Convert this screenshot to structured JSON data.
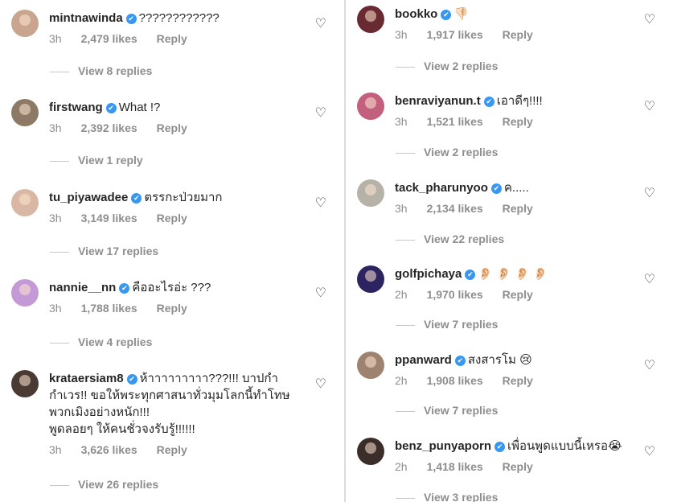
{
  "left": [
    {
      "username": "mintnawinda",
      "text": "????????????",
      "extra": [],
      "time": "3h",
      "likes": "2,479 likes",
      "reply": "Reply",
      "view": "View 8 replies",
      "avatar": "#c9a48f"
    },
    {
      "username": "firstwang",
      "text": "What !?",
      "extra": [],
      "time": "3h",
      "likes": "2,392 likes",
      "reply": "Reply",
      "view": "View 1 reply",
      "avatar": "#8c7a66"
    },
    {
      "username": "tu_piyawadee",
      "text": "ตรรกะป่วยมาก",
      "extra": [],
      "time": "3h",
      "likes": "3,149 likes",
      "reply": "Reply",
      "view": "View 17 replies",
      "avatar": "#d8b8a4"
    },
    {
      "username": "nannie__nn",
      "text": "คืออะไรอ่ะ ???",
      "extra": [],
      "time": "3h",
      "likes": "1,788 likes",
      "reply": "Reply",
      "view": "View 4 replies",
      "avatar": "#c49ad6"
    },
    {
      "username": "krataersiam8",
      "text": "ห้าาาาาาาาา???!!! บาปกำ",
      "extra": [
        "กำเวร!! ขอให้พระทุกศาสนาทั่วมุมโลกนี้ทำโทษ",
        "พวกเมิงอย่างหนัก!!!",
        "พูดลอยๆ ให้คนชั่วจงรับรู้!!!!!!"
      ],
      "time": "3h",
      "likes": "3,626 likes",
      "reply": "Reply",
      "view": "View 26 replies",
      "avatar": "#4a3a34"
    }
  ],
  "right": [
    {
      "username": "bookko",
      "text": "👎🏻",
      "extra": [],
      "time": "3h",
      "likes": "1,917 likes",
      "reply": "Reply",
      "view": "View 2 replies",
      "avatar": "#6a2a32"
    },
    {
      "username": "benraviyanun.t",
      "text": "เอาดีๆ!!!!",
      "extra": [],
      "time": "3h",
      "likes": "1,521 likes",
      "reply": "Reply",
      "view": "View 2 replies",
      "avatar": "#c2607e"
    },
    {
      "username": "tack_pharunyoo",
      "text": "ค.....",
      "extra": [],
      "time": "3h",
      "likes": "2,134 likes",
      "reply": "Reply",
      "view": "View 22 replies",
      "avatar": "#b7b2a8"
    },
    {
      "username": "golfpichaya",
      "text": "👂🏻 👂🏻 👂🏻 👂🏻",
      "extra": [],
      "time": "2h",
      "likes": "1,970 likes",
      "reply": "Reply",
      "view": "View 7 replies",
      "avatar": "#2c2460"
    },
    {
      "username": "ppanward",
      "text": "สงสารโม 😢",
      "extra": [],
      "time": "2h",
      "likes": "1,908 likes",
      "reply": "Reply",
      "view": "View 7 replies",
      "avatar": "#9e8270"
    },
    {
      "username": "benz_punyaporn",
      "text": "เพื่อนพูดแบบนี้เหรอ😭",
      "extra": [],
      "time": "2h",
      "likes": "1,418 likes",
      "reply": "Reply",
      "view": "View 3 replies",
      "avatar": "#3b2e2a"
    }
  ],
  "verified_mark": "✔",
  "heart_icon": "♡",
  "colors": {
    "verified": "#3897f0",
    "muted": "#8e8e8e",
    "text": "#262626"
  }
}
